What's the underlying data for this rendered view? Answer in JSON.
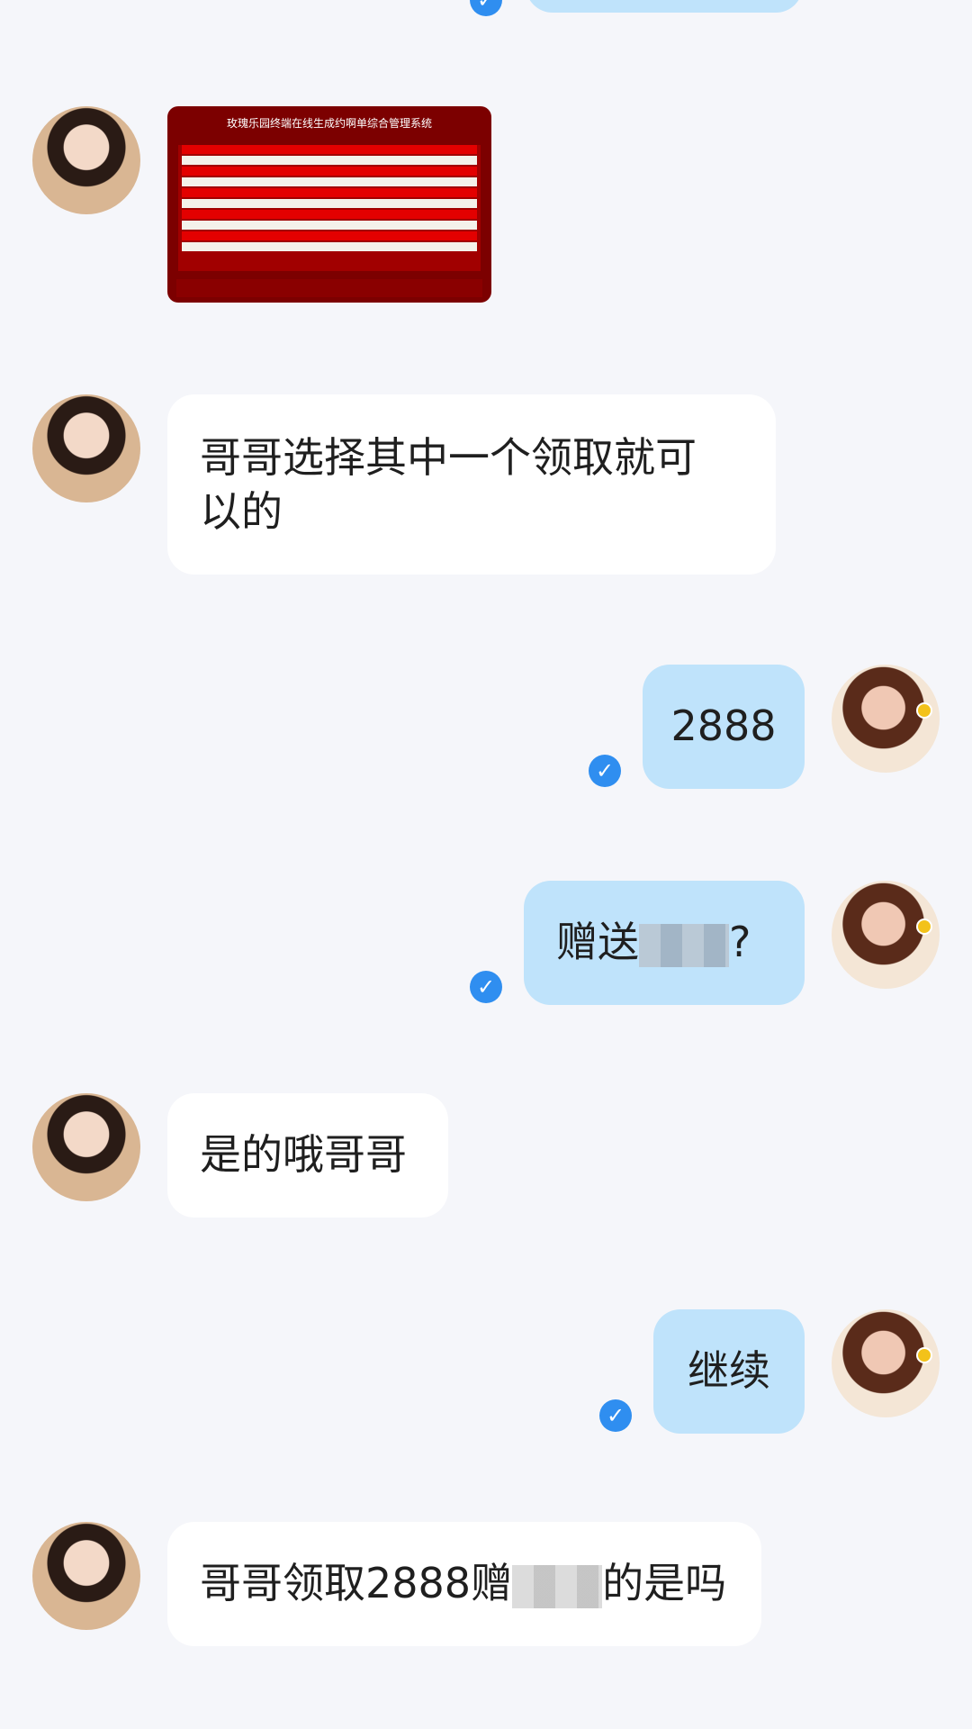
{
  "messages": [
    {
      "from": "contact",
      "type": "image",
      "image_title": "玫瑰乐园终端在线生成约啊单综合管理系统"
    },
    {
      "from": "contact",
      "type": "text",
      "lines": [
        "哥哥选择其中一个领取就可",
        "以的"
      ]
    },
    {
      "from": "self",
      "type": "text",
      "text": "2888"
    },
    {
      "from": "self",
      "type": "text",
      "prefix": "赠送",
      "suffix": "?"
    },
    {
      "from": "contact",
      "type": "text",
      "text": "是的哦哥哥"
    },
    {
      "from": "self",
      "type": "text",
      "text": "继续"
    },
    {
      "from": "contact",
      "type": "text",
      "prefix": "哥哥领取2888赠",
      "suffix": "的是吗"
    }
  ],
  "icons": {
    "read": "check-circle-icon"
  },
  "colors": {
    "background": "#f5f6fa",
    "incoming": "#ffffff",
    "outgoing": "#bfe3fb",
    "check": "#2f8ef0"
  }
}
